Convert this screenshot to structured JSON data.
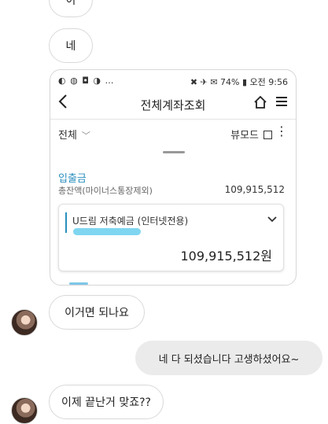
{
  "chat": {
    "top_bubble": "이",
    "bubble_ne": "네",
    "msg_question": "이거면 되나요",
    "msg_reply": "네 다 되셨습니다 고생하셨어요~",
    "msg_confirm": "이제 끝난거 맞죠??"
  },
  "screenshot": {
    "status_left": "◐ ◍ ◘ ◑ …",
    "status_right": "✖ ✈ ✉ 74% ▮ 오전 9:56",
    "title": "전체계좌조회",
    "filter_label": "전체",
    "view_mode_label": "뷰모드",
    "section_label": "입출금",
    "total_label": "총잔액(마이너스통장제외)",
    "total_amount": "109,915,512",
    "account_name": "U드림 저축예금 (인터넷전용)",
    "account_amount": "109,915,512원",
    "icons": {
      "back": "chevron-left-icon",
      "home": "home-icon",
      "menu": "hamburger-icon",
      "filter_dropdown": "chevron-down-icon",
      "more": "kebab-icon",
      "expand": "chevron-down-icon"
    },
    "colors": {
      "accent": "#2b8fbf",
      "masked_number": "#7fd6f0"
    }
  }
}
